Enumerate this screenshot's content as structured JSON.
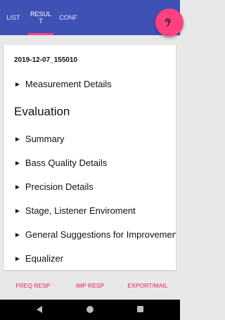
{
  "tabs": {
    "list": "LIST",
    "result": "RESUL\nT",
    "conf": "CONF"
  },
  "fab": {
    "icon": "ear-icon"
  },
  "result": {
    "timestamp": "2019-12-07_155010",
    "measurement_details": "Measurement Details",
    "evaluation_heading": "Evaluation",
    "sections": [
      "Summary",
      "Bass Quality Details",
      "Precision Details",
      "Stage, Listener Enviroment",
      "General Suggestions for Improvement",
      "Equalizer"
    ],
    "arrow": "►"
  },
  "bottom": {
    "freq_resp": "FREQ RESP",
    "imp_resp": "IMP RESP",
    "export_mail": "EXPORT/MAIL"
  },
  "colors": {
    "appbar": "#3f51b5",
    "accent": "#ff4081",
    "action_text": "#e91e63"
  }
}
